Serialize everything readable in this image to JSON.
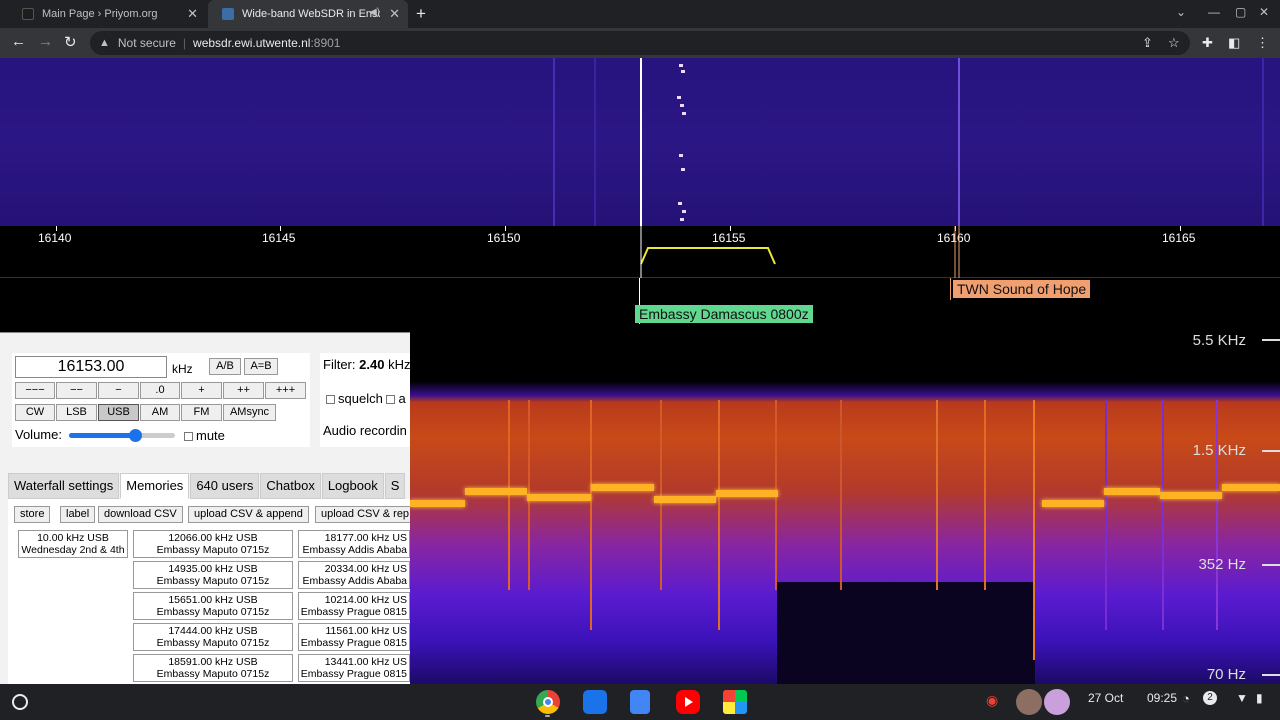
{
  "browser": {
    "tabs": [
      {
        "title": "Main Page › Priyom.org"
      },
      {
        "title": "Wide-band WebSDR in Ensch"
      }
    ],
    "security": "Not secure",
    "url_host": "websdr.ewi.utwente.nl",
    "url_port": ":8901"
  },
  "scale": {
    "ticks": [
      "16140",
      "16145",
      "16150",
      "16155",
      "16160",
      "16165"
    ]
  },
  "markers": {
    "twn": "TWN Sound of Hope",
    "embassy": "Embassy Damascus 0800z"
  },
  "panel": {
    "frequency": "16153.00",
    "unit": "kHz",
    "ab": "A/B",
    "aeqb": "A=B",
    "steps": [
      "−−−",
      "−−",
      "−",
      ".0",
      "+",
      "++",
      "+++"
    ],
    "modes": [
      "CW",
      "LSB",
      "USB",
      "AM",
      "FM",
      "AMsync"
    ],
    "selected_mode": "USB",
    "volume_label": "Volume:",
    "volume_level": 0.62,
    "mute": "mute",
    "filter_label": "Filter:",
    "filter_value": "2.40",
    "filter_unit": "kHz",
    "squelch": "squelch",
    "squelch_cut": "a",
    "audio_recording": "Audio recordin"
  },
  "tabs": [
    "Waterfall settings",
    "Memories",
    "640 users",
    "Chatbox",
    "Logbook",
    "S"
  ],
  "active_tab": "Memories",
  "memory_buttons": [
    "store",
    "label",
    "download CSV",
    "upload CSV & append",
    "upload CSV & rep"
  ],
  "memories": {
    "col1": [
      {
        "l1": "10.00 kHz USB",
        "l2": "Wednesday 2nd & 4th"
      }
    ],
    "col2": [
      {
        "l1": "12066.00 kHz USB",
        "l2": "Embassy Maputo 0715z"
      },
      {
        "l1": "14935.00 kHz USB",
        "l2": "Embassy Maputo 0715z"
      },
      {
        "l1": "15651.00 kHz USB",
        "l2": "Embassy Maputo 0715z"
      },
      {
        "l1": "17444.00 kHz USB",
        "l2": "Embassy Maputo 0715z"
      },
      {
        "l1": "18591.00 kHz USB",
        "l2": "Embassy Maputo 0715z"
      }
    ],
    "col3": [
      {
        "l1": "18177.00 kHz US",
        "l2": "Embassy Addis Ababa"
      },
      {
        "l1": "20334.00 kHz US",
        "l2": "Embassy Addis Ababa"
      },
      {
        "l1": "10214.00 kHz US",
        "l2": "Embassy Prague 0815"
      },
      {
        "l1": "11561.00 kHz US",
        "l2": "Embassy Prague 0815"
      },
      {
        "l1": "13441.00 kHz US",
        "l2": "Embassy Prague 0815"
      }
    ]
  },
  "spectrogram_labels": [
    "5.5 KHz",
    "1.5 KHz",
    "352 Hz",
    "70 Hz"
  ],
  "shelf": {
    "date": "27 Oct",
    "time": "09:25",
    "notif": "2"
  }
}
